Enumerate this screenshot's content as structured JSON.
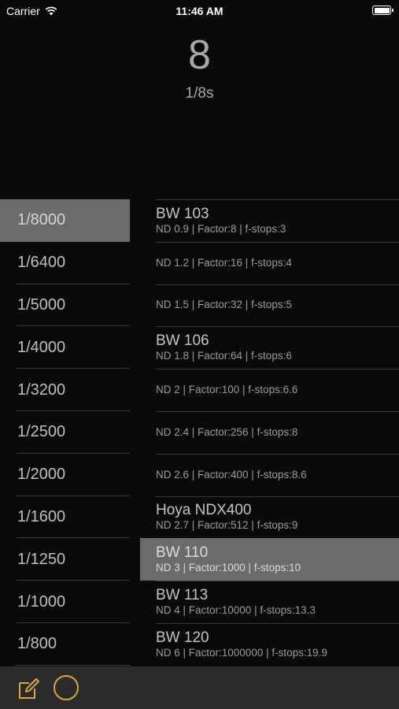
{
  "status_bar": {
    "carrier": "Carrier",
    "time": "11:46 AM",
    "icons": [
      "wifi-icon",
      "battery-icon"
    ]
  },
  "result": {
    "value": "8",
    "subtitle": "1/8s"
  },
  "shutter_speeds": [
    {
      "label": "1/8000",
      "selected": true
    },
    {
      "label": "1/6400",
      "selected": false
    },
    {
      "label": "1/5000",
      "selected": false
    },
    {
      "label": "1/4000",
      "selected": false
    },
    {
      "label": "1/3200",
      "selected": false
    },
    {
      "label": "1/2500",
      "selected": false
    },
    {
      "label": "1/2000",
      "selected": false
    },
    {
      "label": "1/1600",
      "selected": false
    },
    {
      "label": "1/1250",
      "selected": false
    },
    {
      "label": "1/1000",
      "selected": false
    },
    {
      "label": "1/800",
      "selected": false
    }
  ],
  "filters": [
    {
      "name": "BW 103",
      "detail": "ND 0.9 | Factor:8 | f-stops:3",
      "selected": false
    },
    {
      "name": "",
      "detail": "ND 1.2 | Factor:16 | f-stops:4",
      "selected": false
    },
    {
      "name": "",
      "detail": "ND 1.5 | Factor:32 | f-stops:5",
      "selected": false
    },
    {
      "name": "BW 106",
      "detail": "ND 1.8 | Factor:64 | f-stops:6",
      "selected": false
    },
    {
      "name": "",
      "detail": "ND 2 | Factor:100 | f-stops:6.6",
      "selected": false
    },
    {
      "name": "",
      "detail": "ND 2.4 | Factor:256 | f-stops:8",
      "selected": false
    },
    {
      "name": "",
      "detail": "ND 2.6 | Factor:400 | f-stops:8.6",
      "selected": false
    },
    {
      "name": "Hoya NDX400",
      "detail": "ND 2.7 | Factor:512 | f-stops:9",
      "selected": false
    },
    {
      "name": "BW 110",
      "detail": "ND 3 | Factor:1000 | f-stops:10",
      "selected": true
    },
    {
      "name": "BW 113",
      "detail": "ND 4 | Factor:10000 | f-stops:13.3",
      "selected": false
    },
    {
      "name": "BW 120",
      "detail": "ND 6 | Factor:1000000 | f-stops:19.9",
      "selected": false
    }
  ],
  "toolbar": {
    "icons": [
      "edit-icon",
      "circle-icon"
    ],
    "accent_color": "#e0a23a"
  }
}
